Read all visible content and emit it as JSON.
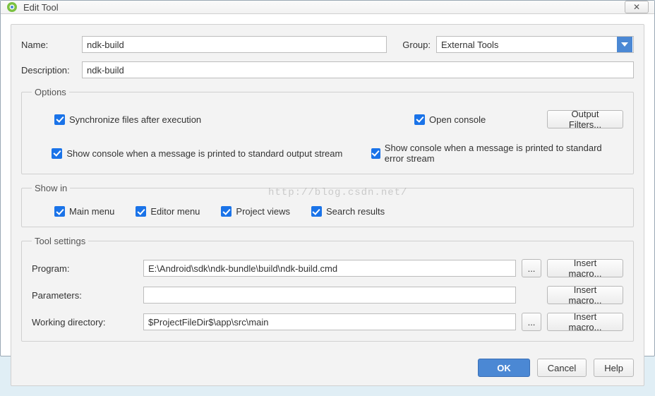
{
  "window": {
    "title": "Edit Tool",
    "close_glyph": "✕"
  },
  "form": {
    "name_label": "Name:",
    "name_value": "ndk-build",
    "group_label": "Group:",
    "group_value": "External Tools",
    "description_label": "Description:",
    "description_value": "ndk-build"
  },
  "options": {
    "legend": "Options",
    "sync_label": "Synchronize files after execution",
    "open_console_label": "Open console",
    "output_filters_label": "Output Filters...",
    "stdout_label": "Show console when a message is printed to standard output stream",
    "stderr_label": "Show console when a message is printed to standard error stream"
  },
  "show_in": {
    "legend": "Show in",
    "main_menu": "Main menu",
    "editor_menu": "Editor menu",
    "project_views": "Project views",
    "search_results": "Search results"
  },
  "tool_settings": {
    "legend": "Tool settings",
    "program_label": "Program:",
    "program_value": "E:\\Android\\sdk\\ndk-bundle\\build\\ndk-build.cmd",
    "parameters_label": "Parameters:",
    "parameters_value": "",
    "workdir_label": "Working directory:",
    "workdir_value": "$ProjectFileDir$\\app\\src\\main",
    "browse_glyph": "...",
    "insert_macro_label": "Insert macro..."
  },
  "footer": {
    "ok": "OK",
    "cancel": "Cancel",
    "help": "Help"
  },
  "watermark": "http://blog.csdn.net/"
}
